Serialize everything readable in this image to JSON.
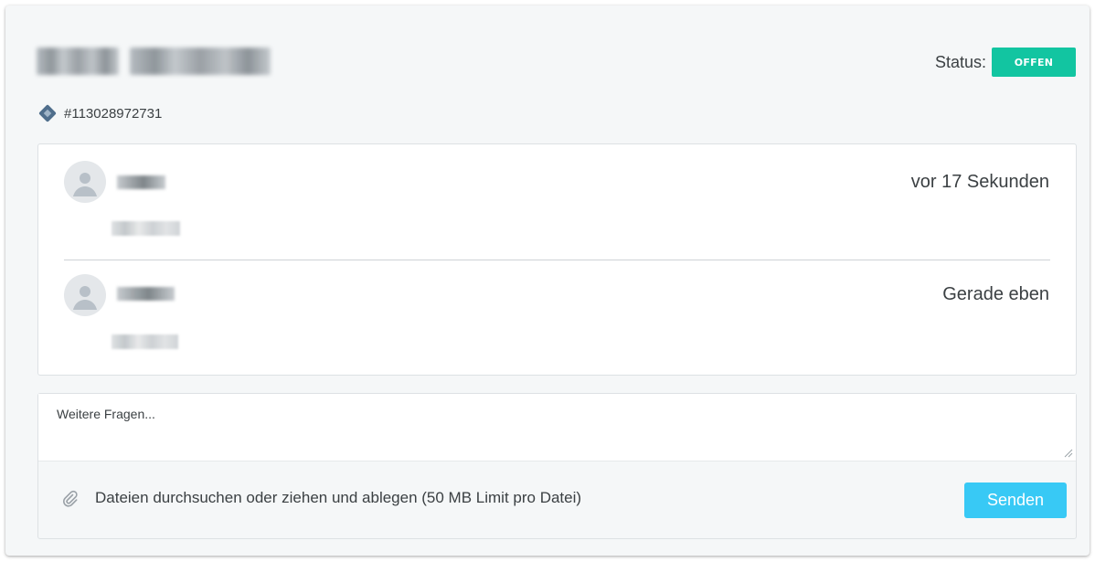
{
  "ticket": {
    "status_label": "Status:",
    "status_value": "OFFEN",
    "number": "#113028972731"
  },
  "messages": [
    {
      "time": "vor 17 Sekunden"
    },
    {
      "time": "Gerade eben"
    }
  ],
  "composer": {
    "placeholder": "Weitere Fragen...",
    "attach_text": "Dateien durchsuchen oder ziehen und ablegen  (50 MB Limit pro Datei)",
    "send_label": "Senden"
  },
  "icons": {
    "ticket": "ticket-icon",
    "avatar": "user-avatar-icon",
    "attach": "paperclip-icon",
    "resize": "resize-handle-icon"
  },
  "colors": {
    "status_badge": "#12c5a1",
    "send_button": "#38c9f5",
    "ticket_icon": "#4f6e8c"
  }
}
